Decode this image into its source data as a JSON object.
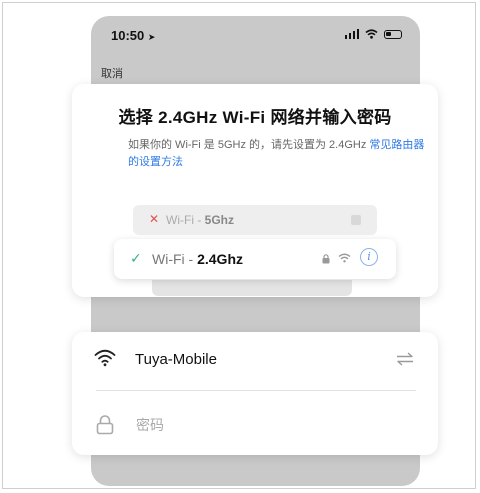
{
  "status_bar": {
    "time": "10:50"
  },
  "nav": {
    "cancel_label": "取消"
  },
  "header": {
    "title": "选择 2.4GHz Wi-Fi 网络并输入密码",
    "subtitle_prefix": "如果你的 Wi-Fi 是 5GHz 的，请先设置为 2.4GHz ",
    "subtitle_link": "常见路由器的设置方法"
  },
  "wifi_illustration": {
    "bad": {
      "prefix": "Wi-Fi - ",
      "band": "5Ghz"
    },
    "good": {
      "prefix": "Wi-Fi - ",
      "band": "2.4Ghz"
    }
  },
  "form": {
    "ssid_value": "Tuya-Mobile",
    "password_placeholder": "密码"
  },
  "colors": {
    "accent_link": "#2f7ae5",
    "check_green": "#36b37e",
    "cross_red": "#e05050",
    "backdrop": "#c9c9c9"
  }
}
